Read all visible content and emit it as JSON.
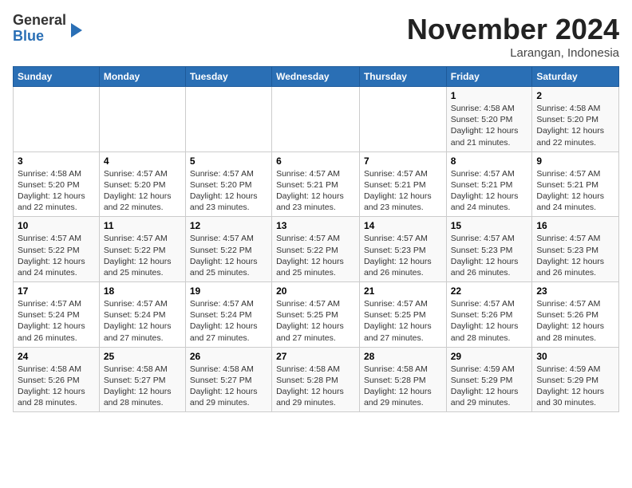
{
  "logo": {
    "general": "General",
    "blue": "Blue"
  },
  "title": "November 2024",
  "subtitle": "Larangan, Indonesia",
  "header_days": [
    "Sunday",
    "Monday",
    "Tuesday",
    "Wednesday",
    "Thursday",
    "Friday",
    "Saturday"
  ],
  "weeks": [
    [
      {
        "day": "",
        "info": ""
      },
      {
        "day": "",
        "info": ""
      },
      {
        "day": "",
        "info": ""
      },
      {
        "day": "",
        "info": ""
      },
      {
        "day": "",
        "info": ""
      },
      {
        "day": "1",
        "info": "Sunrise: 4:58 AM\nSunset: 5:20 PM\nDaylight: 12 hours and 21 minutes."
      },
      {
        "day": "2",
        "info": "Sunrise: 4:58 AM\nSunset: 5:20 PM\nDaylight: 12 hours and 22 minutes."
      }
    ],
    [
      {
        "day": "3",
        "info": "Sunrise: 4:58 AM\nSunset: 5:20 PM\nDaylight: 12 hours and 22 minutes."
      },
      {
        "day": "4",
        "info": "Sunrise: 4:57 AM\nSunset: 5:20 PM\nDaylight: 12 hours and 22 minutes."
      },
      {
        "day": "5",
        "info": "Sunrise: 4:57 AM\nSunset: 5:20 PM\nDaylight: 12 hours and 23 minutes."
      },
      {
        "day": "6",
        "info": "Sunrise: 4:57 AM\nSunset: 5:21 PM\nDaylight: 12 hours and 23 minutes."
      },
      {
        "day": "7",
        "info": "Sunrise: 4:57 AM\nSunset: 5:21 PM\nDaylight: 12 hours and 23 minutes."
      },
      {
        "day": "8",
        "info": "Sunrise: 4:57 AM\nSunset: 5:21 PM\nDaylight: 12 hours and 24 minutes."
      },
      {
        "day": "9",
        "info": "Sunrise: 4:57 AM\nSunset: 5:21 PM\nDaylight: 12 hours and 24 minutes."
      }
    ],
    [
      {
        "day": "10",
        "info": "Sunrise: 4:57 AM\nSunset: 5:22 PM\nDaylight: 12 hours and 24 minutes."
      },
      {
        "day": "11",
        "info": "Sunrise: 4:57 AM\nSunset: 5:22 PM\nDaylight: 12 hours and 25 minutes."
      },
      {
        "day": "12",
        "info": "Sunrise: 4:57 AM\nSunset: 5:22 PM\nDaylight: 12 hours and 25 minutes."
      },
      {
        "day": "13",
        "info": "Sunrise: 4:57 AM\nSunset: 5:22 PM\nDaylight: 12 hours and 25 minutes."
      },
      {
        "day": "14",
        "info": "Sunrise: 4:57 AM\nSunset: 5:23 PM\nDaylight: 12 hours and 26 minutes."
      },
      {
        "day": "15",
        "info": "Sunrise: 4:57 AM\nSunset: 5:23 PM\nDaylight: 12 hours and 26 minutes."
      },
      {
        "day": "16",
        "info": "Sunrise: 4:57 AM\nSunset: 5:23 PM\nDaylight: 12 hours and 26 minutes."
      }
    ],
    [
      {
        "day": "17",
        "info": "Sunrise: 4:57 AM\nSunset: 5:24 PM\nDaylight: 12 hours and 26 minutes."
      },
      {
        "day": "18",
        "info": "Sunrise: 4:57 AM\nSunset: 5:24 PM\nDaylight: 12 hours and 27 minutes."
      },
      {
        "day": "19",
        "info": "Sunrise: 4:57 AM\nSunset: 5:24 PM\nDaylight: 12 hours and 27 minutes."
      },
      {
        "day": "20",
        "info": "Sunrise: 4:57 AM\nSunset: 5:25 PM\nDaylight: 12 hours and 27 minutes."
      },
      {
        "day": "21",
        "info": "Sunrise: 4:57 AM\nSunset: 5:25 PM\nDaylight: 12 hours and 27 minutes."
      },
      {
        "day": "22",
        "info": "Sunrise: 4:57 AM\nSunset: 5:26 PM\nDaylight: 12 hours and 28 minutes."
      },
      {
        "day": "23",
        "info": "Sunrise: 4:57 AM\nSunset: 5:26 PM\nDaylight: 12 hours and 28 minutes."
      }
    ],
    [
      {
        "day": "24",
        "info": "Sunrise: 4:58 AM\nSunset: 5:26 PM\nDaylight: 12 hours and 28 minutes."
      },
      {
        "day": "25",
        "info": "Sunrise: 4:58 AM\nSunset: 5:27 PM\nDaylight: 12 hours and 28 minutes."
      },
      {
        "day": "26",
        "info": "Sunrise: 4:58 AM\nSunset: 5:27 PM\nDaylight: 12 hours and 29 minutes."
      },
      {
        "day": "27",
        "info": "Sunrise: 4:58 AM\nSunset: 5:28 PM\nDaylight: 12 hours and 29 minutes."
      },
      {
        "day": "28",
        "info": "Sunrise: 4:58 AM\nSunset: 5:28 PM\nDaylight: 12 hours and 29 minutes."
      },
      {
        "day": "29",
        "info": "Sunrise: 4:59 AM\nSunset: 5:29 PM\nDaylight: 12 hours and 29 minutes."
      },
      {
        "day": "30",
        "info": "Sunrise: 4:59 AM\nSunset: 5:29 PM\nDaylight: 12 hours and 30 minutes."
      }
    ]
  ]
}
